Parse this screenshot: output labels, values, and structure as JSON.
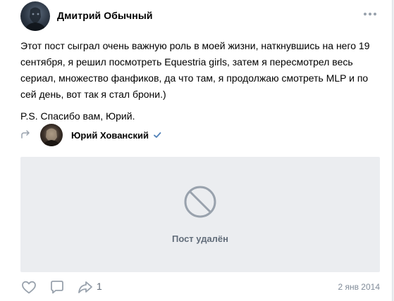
{
  "post": {
    "author_name": "Дмитрий Обычный",
    "text": "Этот пост сыграл очень важную роль в моей жизни, наткнувшись на него 19 сентября, я решил посмотреть Equestria girls, затем я пересмотрел весь сериал, множество фанфиков, да что там, я продолжаю смотреть MLP и по сей день, вот так я стал брони.)",
    "ps": "P.S. Спасибо вам, Юрий.",
    "date": "2 янв 2014"
  },
  "repost": {
    "author_name": "Юрий Хованский",
    "deleted_label": "Пост удалён"
  },
  "actions": {
    "share_count": "1"
  },
  "colors": {
    "accent": "#5181b8",
    "icon_gray": "#99a2ad",
    "muted_text": "#818c99",
    "deleted_bg": "#ebedf0"
  },
  "icons": [
    "more-icon",
    "repost-arrow-icon",
    "verified-icon",
    "ban-icon",
    "like-icon",
    "comment-icon",
    "share-icon"
  ]
}
